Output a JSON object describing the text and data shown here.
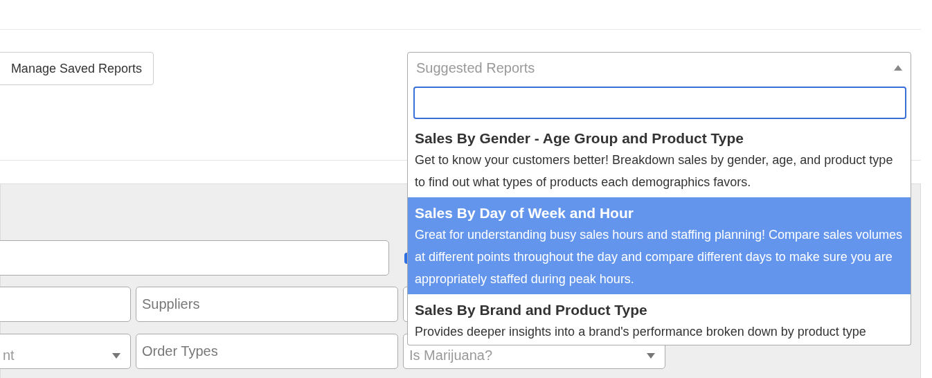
{
  "toolbar": {
    "manage_button": "Manage Saved Reports",
    "suggested_reports": {
      "placeholder": "Suggested Reports",
      "expanded": true,
      "options": [
        {
          "title": "Sales By Gender - Age Group and Product Type",
          "description": "Get to know your customers better! Breakdown sales by gender, age, and product type to find out what types of products each demographics favors.",
          "selected": false
        },
        {
          "title": "Sales By Day of Week and Hour",
          "description": "Great for understanding busy sales hours and staffing planning! Compare sales volumes at different points throughout the day and compare different days to make sure you are appropriately staffed during peak hours.",
          "selected": true
        },
        {
          "title": "Sales By Brand and Product Type",
          "description": "Provides deeper insights into a brand's performance broken down by product type",
          "selected": false
        }
      ]
    }
  },
  "filters": {
    "checkbox": {
      "checked": true
    },
    "rows": [
      [
        {
          "kind": "input"
        },
        {
          "kind": "input",
          "placeholder": "Suppliers"
        },
        {
          "kind": "input"
        }
      ],
      [
        {
          "kind": "select",
          "placeholder": "nt"
        },
        {
          "kind": "input",
          "placeholder": "Order Types"
        },
        {
          "kind": "select",
          "placeholder": "Is Marijuana?"
        }
      ]
    ]
  }
}
